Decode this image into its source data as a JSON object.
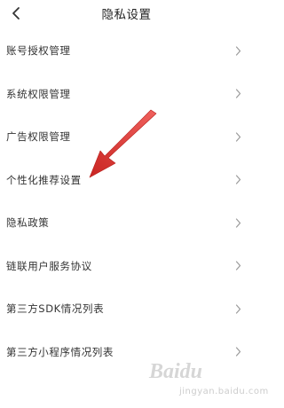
{
  "header": {
    "title": "隐私设置",
    "back_icon": "chevron-left-icon"
  },
  "menu": {
    "items": [
      {
        "label": "账号授权管理",
        "icon": "chevron-right-icon"
      },
      {
        "label": "系统权限管理",
        "icon": "chevron-right-icon"
      },
      {
        "label": "广告权限管理",
        "icon": "chevron-right-icon"
      },
      {
        "label": "个性化推荐设置",
        "icon": "chevron-right-icon"
      },
      {
        "label": "隐私政策",
        "icon": "chevron-right-icon"
      },
      {
        "label": "链联用户服务协议",
        "icon": "chevron-right-icon"
      },
      {
        "label": "第三方SDK情况列表",
        "icon": "chevron-right-icon"
      },
      {
        "label": "第三方小程序情况列表",
        "icon": "chevron-right-icon"
      }
    ]
  },
  "annotation": {
    "color": "#d9302c"
  },
  "watermark": {
    "brand": "Baidu",
    "sub": "jingyan.baidu.com"
  }
}
